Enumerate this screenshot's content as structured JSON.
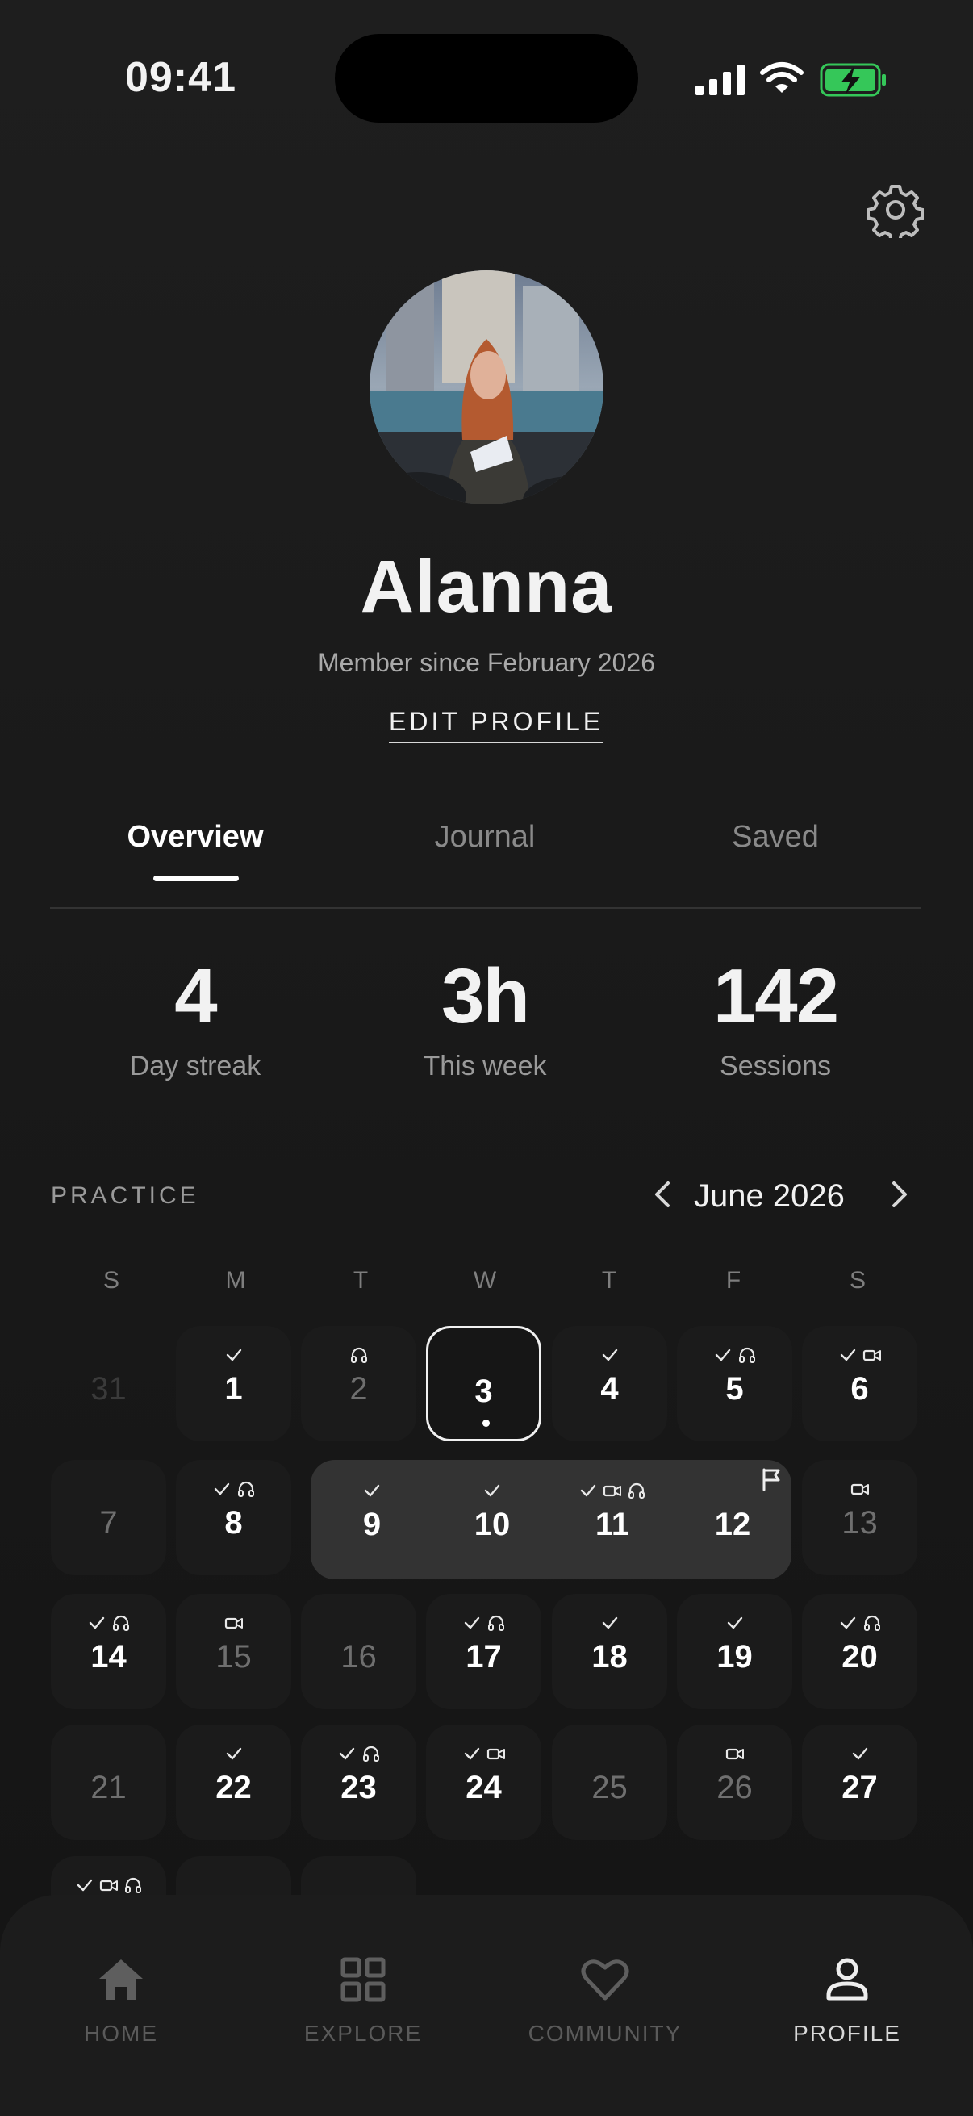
{
  "status_bar": {
    "time": "09:41"
  },
  "profile": {
    "name": "Alanna",
    "member_since": "Member since February 2026",
    "edit_label": "EDIT PROFILE"
  },
  "tabs": [
    {
      "label": "Overview",
      "active": true
    },
    {
      "label": "Journal",
      "active": false
    },
    {
      "label": "Saved",
      "active": false
    }
  ],
  "stats": [
    {
      "value": "4",
      "label": "Day streak"
    },
    {
      "value": "3h",
      "label": "This week"
    },
    {
      "value": "142",
      "label": "Sessions"
    }
  ],
  "practice": {
    "section_label": "PRACTICE",
    "month_label": "June 2026",
    "weekday_headers": [
      "S",
      "M",
      "T",
      "W",
      "T",
      "F",
      "S"
    ],
    "days": [
      {
        "day": "31",
        "state": "outmonth",
        "icons": []
      },
      {
        "day": "1",
        "state": "active",
        "icons": [
          "check"
        ]
      },
      {
        "day": "2",
        "state": "inactive",
        "icons": [
          "headphones"
        ]
      },
      {
        "day": "3",
        "state": "today",
        "icons": []
      },
      {
        "day": "4",
        "state": "active",
        "icons": [
          "check"
        ]
      },
      {
        "day": "5",
        "state": "active",
        "icons": [
          "check",
          "headphones"
        ]
      },
      {
        "day": "6",
        "state": "active",
        "icons": [
          "check",
          "video"
        ]
      },
      {
        "day": "7",
        "state": "inactive",
        "icons": []
      },
      {
        "day": "8",
        "state": "active",
        "icons": [
          "check",
          "headphones"
        ]
      },
      {
        "day": "9",
        "state": "highlight",
        "icons": [
          "check"
        ]
      },
      {
        "day": "10",
        "state": "highlight",
        "icons": [
          "check"
        ]
      },
      {
        "day": "11",
        "state": "highlight",
        "icons": [
          "check",
          "video",
          "headphones"
        ]
      },
      {
        "day": "12",
        "state": "highlight",
        "icons": []
      },
      {
        "day": "13",
        "state": "inactive",
        "icons": [
          "video"
        ]
      },
      {
        "day": "14",
        "state": "active",
        "icons": [
          "check",
          "headphones"
        ]
      },
      {
        "day": "15",
        "state": "inactive",
        "icons": [
          "video"
        ]
      },
      {
        "day": "16",
        "state": "inactive",
        "icons": []
      },
      {
        "day": "17",
        "state": "active",
        "icons": [
          "check",
          "headphones"
        ]
      },
      {
        "day": "18",
        "state": "active",
        "icons": [
          "check"
        ]
      },
      {
        "day": "19",
        "state": "active",
        "icons": [
          "check"
        ]
      },
      {
        "day": "20",
        "state": "active",
        "icons": [
          "check",
          "headphones"
        ]
      },
      {
        "day": "21",
        "state": "inactive",
        "icons": []
      },
      {
        "day": "22",
        "state": "active",
        "icons": [
          "check"
        ]
      },
      {
        "day": "23",
        "state": "active",
        "icons": [
          "check",
          "headphones"
        ]
      },
      {
        "day": "24",
        "state": "active",
        "icons": [
          "check",
          "video"
        ]
      },
      {
        "day": "25",
        "state": "inactive",
        "icons": []
      },
      {
        "day": "26",
        "state": "inactive",
        "icons": [
          "video"
        ]
      },
      {
        "day": "27",
        "state": "active",
        "icons": [
          "check"
        ]
      },
      {
        "day": "",
        "state": "active",
        "icons": [
          "check",
          "video",
          "headphones"
        ]
      },
      {
        "day": "",
        "state": "active",
        "icons": []
      },
      {
        "day": "",
        "state": "active",
        "icons": []
      }
    ]
  },
  "nav": [
    {
      "label": "HOME",
      "icon": "home-icon",
      "active": false
    },
    {
      "label": "EXPLORE",
      "icon": "grid-icon",
      "active": false
    },
    {
      "label": "COMMUNITY",
      "icon": "heart-icon",
      "active": false
    },
    {
      "label": "PROFILE",
      "icon": "person-icon",
      "active": true
    }
  ],
  "colors": {
    "background": "#1a1a1a",
    "battery": "#35c759",
    "highlight_band": "#333333"
  }
}
